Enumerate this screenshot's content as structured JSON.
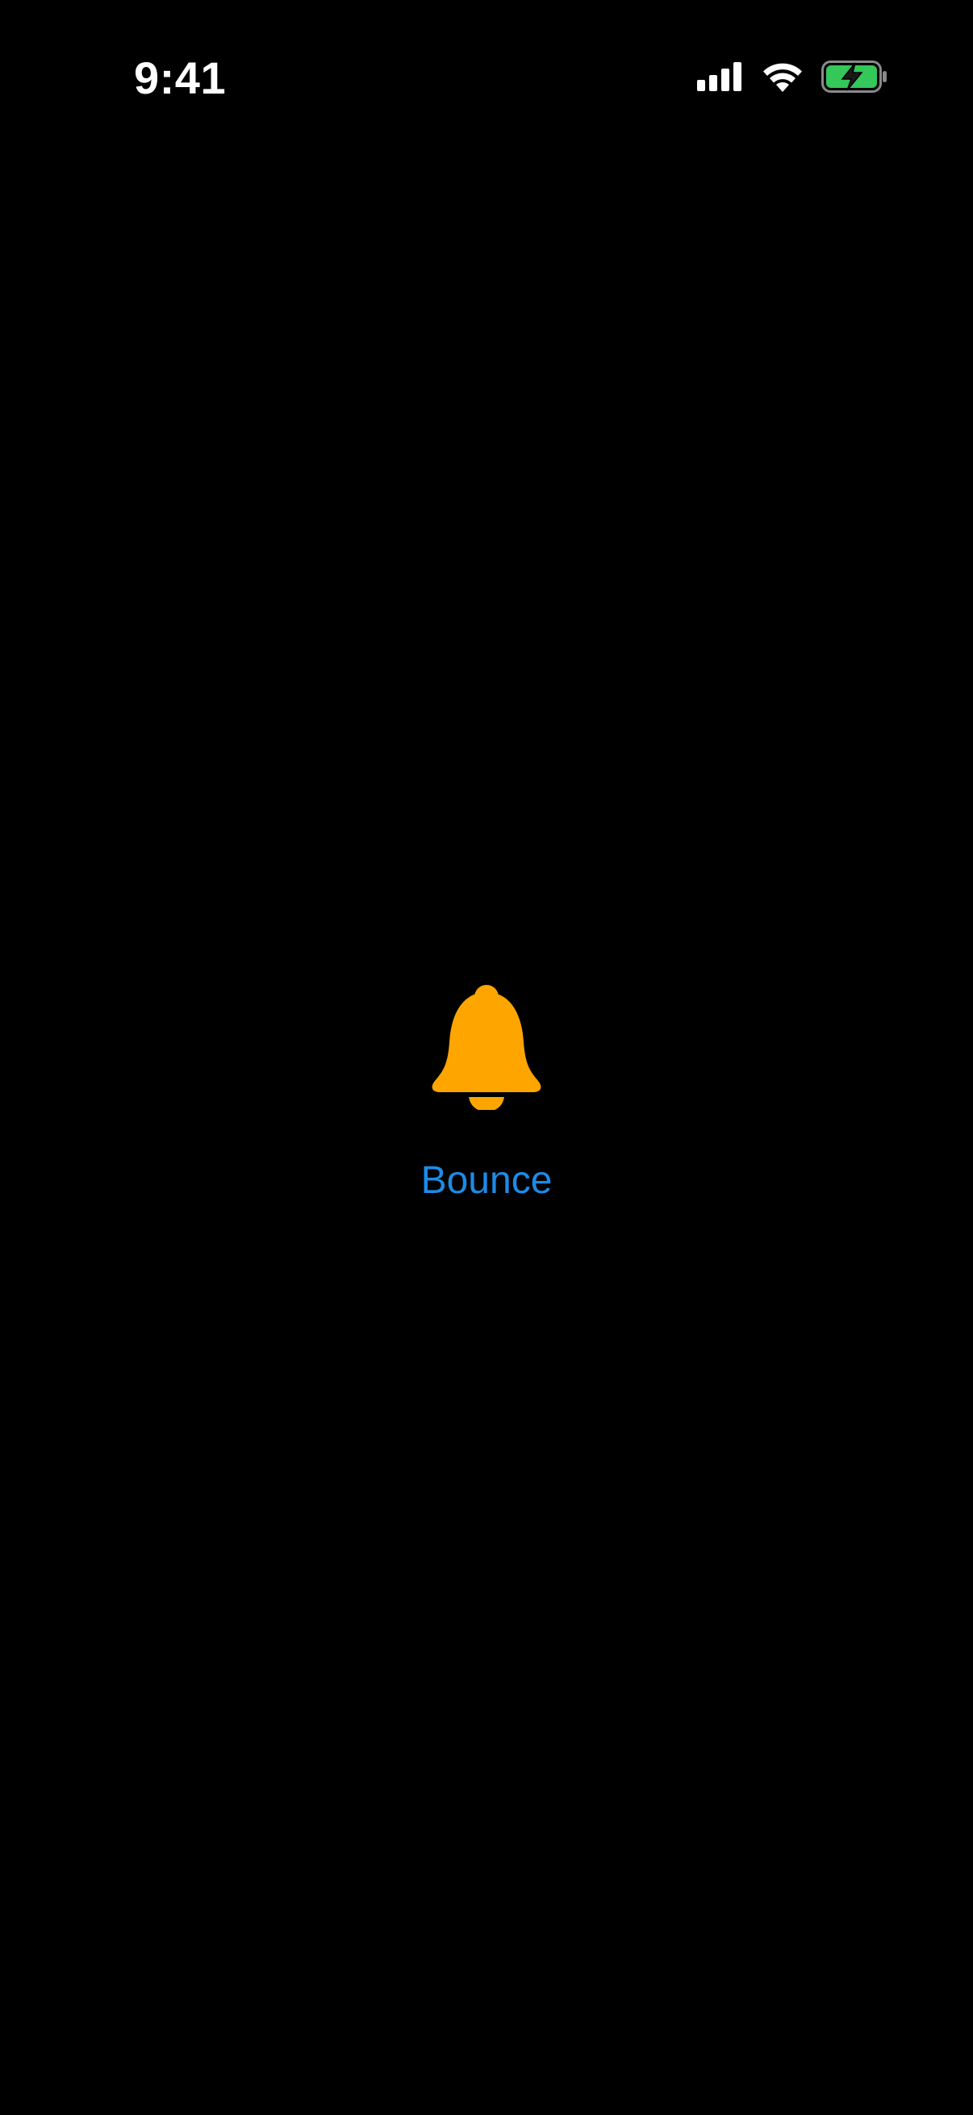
{
  "status_bar": {
    "time": "9:41",
    "signal_icon": "cellular-signal-icon",
    "wifi_icon": "wifi-icon",
    "battery_icon": "battery-charging-icon",
    "battery_color": "#34C759"
  },
  "main": {
    "icon": "bell-icon",
    "icon_color": "#FFA500",
    "button_label": "Bounce",
    "button_color": "#1E8BE6"
  }
}
